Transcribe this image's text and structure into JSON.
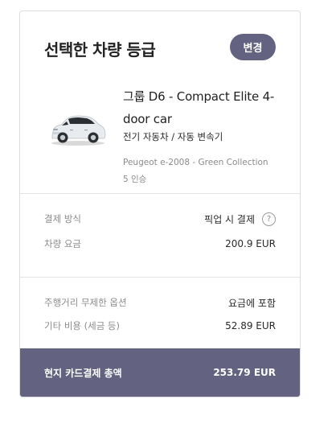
{
  "summary": {
    "title": "선택한 차량 등급",
    "change_label": "변경"
  },
  "vehicle": {
    "name": "그룹 D6 - Compact Elite 4-door car",
    "type": "전기 자동차 / 자동 변속기",
    "model": "Peugeot e-2008 - Green Collection",
    "seats": "5 인승"
  },
  "payment": {
    "method_label": "결제 방식",
    "method_value": "픽업 시 결제",
    "help_glyph": "?",
    "rate_label": "차량 요금",
    "rate_value": "200.9 EUR"
  },
  "extras": {
    "mileage_label": "주행거리 무제한 옵션",
    "mileage_value": "요금에 포함",
    "other_label": "기타 비용 (세금 등)",
    "other_value": "52.89 EUR"
  },
  "total": {
    "label": "현지 카드결제 총액",
    "value": "253.79 EUR"
  },
  "colors": {
    "accent": "#636381",
    "car_body": "#e9ecef",
    "car_dark": "#2b2e33"
  },
  "icons": {
    "help": "question-circle-icon",
    "car": "car-image"
  }
}
